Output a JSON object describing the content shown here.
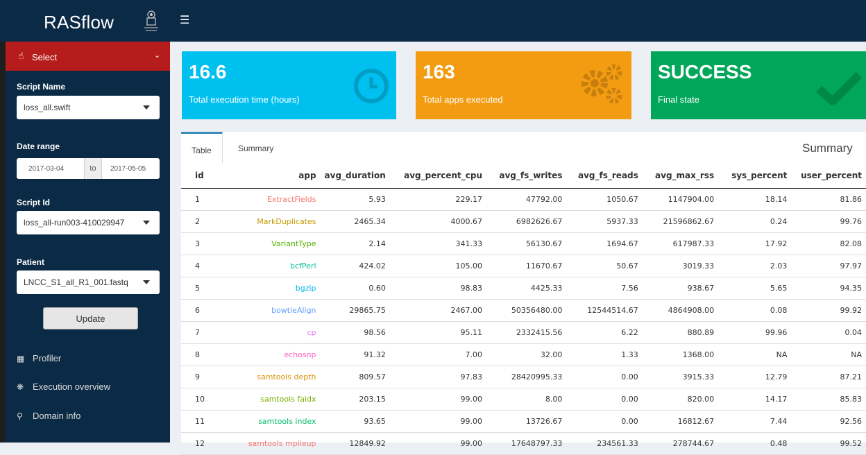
{
  "header": {
    "app_title": "RASflow",
    "menu_icon": "hamburger-icon"
  },
  "sidebar": {
    "select_label": "Select",
    "script_name": {
      "label": "Script Name",
      "value": "loss_all.swift"
    },
    "date_range": {
      "label": "Date range",
      "start": "2017-03-04",
      "separator": "to",
      "end": "2017-05-05"
    },
    "script_id": {
      "label": "Script Id",
      "value": "loss_all-run003-410029947"
    },
    "patient": {
      "label": "Patient",
      "value": "LNCC_S1_all_R1_001.fastq"
    },
    "update_label": "Update",
    "menu": [
      {
        "label": "Profiler",
        "icon": "bar-chart-icon"
      },
      {
        "label": "Execution overview",
        "icon": "spinner-icon"
      },
      {
        "label": "Domain info",
        "icon": "search-icon"
      }
    ]
  },
  "infoboxes": [
    {
      "value": "16.6",
      "label": "Total execution time (hours)",
      "color": "#00c0ef",
      "icon": "clock-icon"
    },
    {
      "value": "163",
      "label": "Total apps executed",
      "color": "#f39c12",
      "icon": "gears-icon"
    },
    {
      "value": "SUCCESS",
      "label": "Final state",
      "color": "#00a65a",
      "icon": "check-icon"
    }
  ],
  "tabs": {
    "items": [
      "Table",
      "Summary"
    ],
    "active": "Table",
    "panel_title": "Summary"
  },
  "table": {
    "columns": [
      "id",
      "app",
      "avg_duration",
      "avg_percent_cpu",
      "avg_fs_writes",
      "avg_fs_reads",
      "avg_max_rss",
      "sys_percent",
      "user_percent"
    ],
    "rows": [
      {
        "cells": [
          "1",
          "ExtractFields",
          "5.93",
          "229.17",
          "47792.00",
          "1050.67",
          "1147904.00",
          "18.14",
          "81.86"
        ],
        "app_color": "#f8766d"
      },
      {
        "cells": [
          "2",
          "MarkDuplicates",
          "2465.34",
          "4000.67",
          "6982626.67",
          "5937.33",
          "21596862.67",
          "0.24",
          "99.76"
        ],
        "app_color": "#c49a00"
      },
      {
        "cells": [
          "3",
          "VariantType",
          "2.14",
          "341.33",
          "56130.67",
          "1694.67",
          "617987.33",
          "17.92",
          "82.08"
        ],
        "app_color": "#53b400"
      },
      {
        "cells": [
          "4",
          "bcfPerl",
          "424.02",
          "105.00",
          "11670.67",
          "50.67",
          "3019.33",
          "2.03",
          "97.97"
        ],
        "app_color": "#00c094"
      },
      {
        "cells": [
          "5",
          "bgzip",
          "0.60",
          "98.83",
          "4425.33",
          "7.56",
          "938.67",
          "5.65",
          "94.35"
        ],
        "app_color": "#00b6eb"
      },
      {
        "cells": [
          "6",
          "bowtieAlign",
          "29865.75",
          "2467.00",
          "50356480.00",
          "12544514.67",
          "4864908.00",
          "0.08",
          "99.92"
        ],
        "app_color": "#619cff"
      },
      {
        "cells": [
          "7",
          "cp",
          "98.56",
          "95.11",
          "2332415.56",
          "6.22",
          "880.89",
          "99.96",
          "0.04"
        ],
        "app_color": "#db72fb"
      },
      {
        "cells": [
          "8",
          "echosnp",
          "91.32",
          "7.00",
          "32.00",
          "1.33",
          "1368.00",
          "NA",
          "NA"
        ],
        "app_color": "#ff61c3"
      },
      {
        "cells": [
          "9",
          "samtools depth",
          "809.57",
          "97.83",
          "28420995.33",
          "0.00",
          "3915.33",
          "12.79",
          "87.21"
        ],
        "app_color": "#d89000"
      },
      {
        "cells": [
          "10",
          "samtools faidx",
          "203.15",
          "99.00",
          "8.00",
          "0.00",
          "820.00",
          "14.17",
          "85.83"
        ],
        "app_color": "#7cae00"
      },
      {
        "cells": [
          "11",
          "samtools index",
          "93.65",
          "99.00",
          "13726.67",
          "0.00",
          "16812.67",
          "7.44",
          "92.56"
        ],
        "app_color": "#00be67"
      },
      {
        "cells": [
          "12",
          "samtools mpileup",
          "12849.92",
          "99.00",
          "17648797.33",
          "234561.33",
          "278744.67",
          "0.48",
          "99.52"
        ],
        "app_color": "#f8766d"
      }
    ]
  }
}
